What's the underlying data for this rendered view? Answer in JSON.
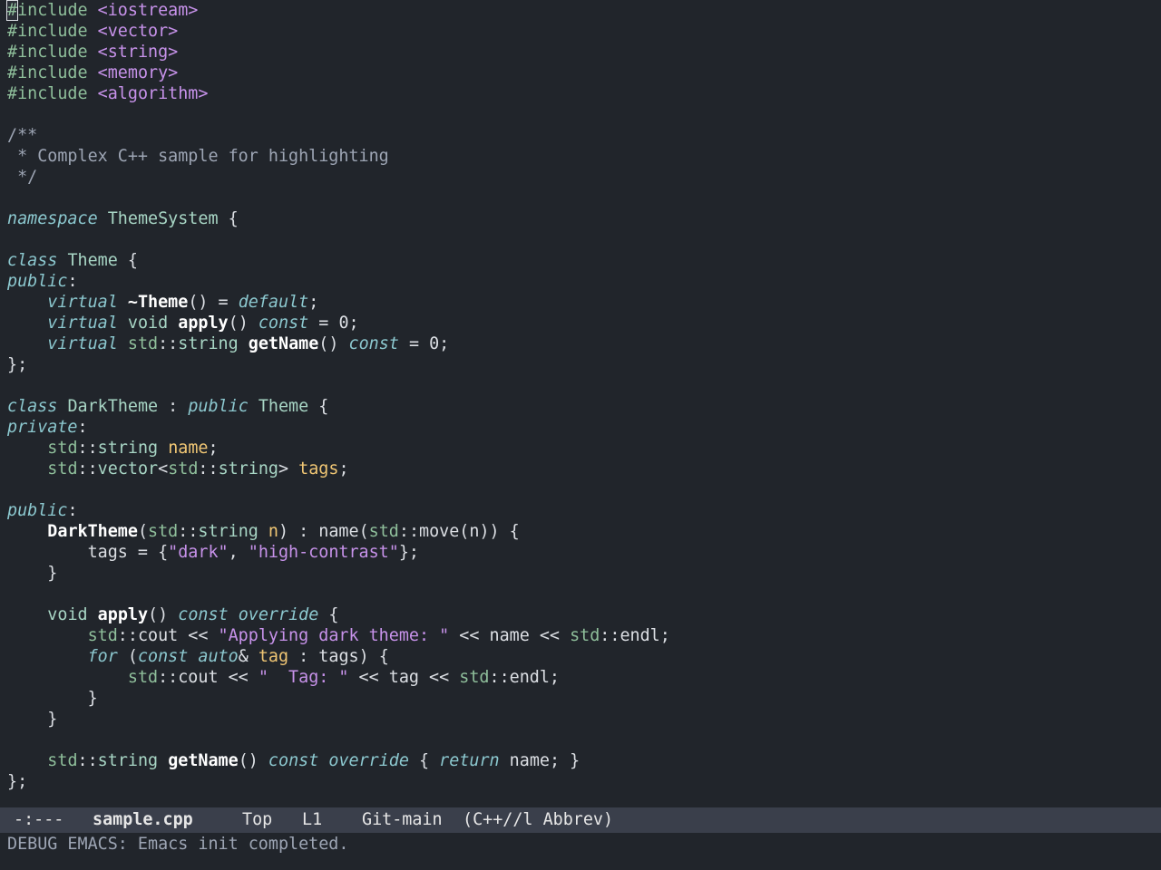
{
  "buffer": {
    "lines": [
      [
        [
          "pp",
          "#include "
        ],
        [
          "inc",
          "<iostream>"
        ]
      ],
      [
        [
          "pp",
          "#include "
        ],
        [
          "inc",
          "<vector>"
        ]
      ],
      [
        [
          "pp",
          "#include "
        ],
        [
          "inc",
          "<string>"
        ]
      ],
      [
        [
          "pp",
          "#include "
        ],
        [
          "inc",
          "<memory>"
        ]
      ],
      [
        [
          "pp",
          "#include "
        ],
        [
          "inc",
          "<algorithm>"
        ]
      ],
      [],
      [
        [
          "cm",
          "/**"
        ]
      ],
      [
        [
          "cm",
          " * Complex C++ sample for highlighting"
        ]
      ],
      [
        [
          "cm",
          " */"
        ]
      ],
      [],
      [
        [
          "kw",
          "namespace"
        ],
        [
          "pl",
          " "
        ],
        [
          "ty",
          "ThemeSystem"
        ],
        [
          "pl",
          " {"
        ]
      ],
      [],
      [
        [
          "kw",
          "class"
        ],
        [
          "pl",
          " "
        ],
        [
          "ty",
          "Theme"
        ],
        [
          "pl",
          " {"
        ]
      ],
      [
        [
          "kw",
          "public"
        ],
        [
          "pl",
          ":"
        ]
      ],
      [
        [
          "pl",
          "    "
        ],
        [
          "kw",
          "virtual"
        ],
        [
          "pl",
          " "
        ],
        [
          "fn",
          "~Theme"
        ],
        [
          "pl",
          "() = "
        ],
        [
          "kw",
          "default"
        ],
        [
          "pl",
          ";"
        ]
      ],
      [
        [
          "pl",
          "    "
        ],
        [
          "kw",
          "virtual"
        ],
        [
          "pl",
          " "
        ],
        [
          "ty",
          "void"
        ],
        [
          "pl",
          " "
        ],
        [
          "fn",
          "apply"
        ],
        [
          "pl",
          "() "
        ],
        [
          "kw",
          "const"
        ],
        [
          "pl",
          " = 0;"
        ]
      ],
      [
        [
          "pl",
          "    "
        ],
        [
          "kw",
          "virtual"
        ],
        [
          "pl",
          " "
        ],
        [
          "ns",
          "std"
        ],
        [
          "pl",
          "::"
        ],
        [
          "ty",
          "string"
        ],
        [
          "pl",
          " "
        ],
        [
          "fn",
          "getName"
        ],
        [
          "pl",
          "() "
        ],
        [
          "kw",
          "const"
        ],
        [
          "pl",
          " = 0;"
        ]
      ],
      [
        [
          "pl",
          "};"
        ]
      ],
      [],
      [
        [
          "kw",
          "class"
        ],
        [
          "pl",
          " "
        ],
        [
          "ty",
          "DarkTheme"
        ],
        [
          "pl",
          " : "
        ],
        [
          "kw",
          "public"
        ],
        [
          "pl",
          " "
        ],
        [
          "ty",
          "Theme"
        ],
        [
          "pl",
          " {"
        ]
      ],
      [
        [
          "kw",
          "private"
        ],
        [
          "pl",
          ":"
        ]
      ],
      [
        [
          "pl",
          "    "
        ],
        [
          "ns",
          "std"
        ],
        [
          "pl",
          "::"
        ],
        [
          "ty",
          "string"
        ],
        [
          "pl",
          " "
        ],
        [
          "vr",
          "name"
        ],
        [
          "pl",
          ";"
        ]
      ],
      [
        [
          "pl",
          "    "
        ],
        [
          "ns",
          "std"
        ],
        [
          "pl",
          "::"
        ],
        [
          "ty",
          "vector"
        ],
        [
          "pl",
          "<"
        ],
        [
          "ns",
          "std"
        ],
        [
          "pl",
          "::"
        ],
        [
          "ty",
          "string"
        ],
        [
          "pl",
          "> "
        ],
        [
          "vr",
          "tags"
        ],
        [
          "pl",
          ";"
        ]
      ],
      [],
      [
        [
          "kw",
          "public"
        ],
        [
          "pl",
          ":"
        ]
      ],
      [
        [
          "pl",
          "    "
        ],
        [
          "fn",
          "DarkTheme"
        ],
        [
          "pl",
          "("
        ],
        [
          "ns",
          "std"
        ],
        [
          "pl",
          "::"
        ],
        [
          "ty",
          "string"
        ],
        [
          "pl",
          " "
        ],
        [
          "vr",
          "n"
        ],
        [
          "pl",
          ") : name("
        ],
        [
          "ns",
          "std"
        ],
        [
          "pl",
          "::move(n)) {"
        ]
      ],
      [
        [
          "pl",
          "        tags = {"
        ],
        [
          "st",
          "\"dark\""
        ],
        [
          "pl",
          ", "
        ],
        [
          "st",
          "\"high-contrast\""
        ],
        [
          "pl",
          "};"
        ]
      ],
      [
        [
          "pl",
          "    }"
        ]
      ],
      [],
      [
        [
          "pl",
          "    "
        ],
        [
          "ty",
          "void"
        ],
        [
          "pl",
          " "
        ],
        [
          "fn",
          "apply"
        ],
        [
          "pl",
          "() "
        ],
        [
          "kw",
          "const"
        ],
        [
          "pl",
          " "
        ],
        [
          "kw",
          "override"
        ],
        [
          "pl",
          " {"
        ]
      ],
      [
        [
          "pl",
          "        "
        ],
        [
          "ns",
          "std"
        ],
        [
          "pl",
          "::cout << "
        ],
        [
          "st",
          "\"Applying dark theme: \""
        ],
        [
          "pl",
          " << name << "
        ],
        [
          "ns",
          "std"
        ],
        [
          "pl",
          "::endl;"
        ]
      ],
      [
        [
          "pl",
          "        "
        ],
        [
          "kw",
          "for"
        ],
        [
          "pl",
          " ("
        ],
        [
          "kw",
          "const"
        ],
        [
          "pl",
          " "
        ],
        [
          "kw",
          "auto"
        ],
        [
          "pl",
          "& "
        ],
        [
          "vr",
          "tag"
        ],
        [
          "pl",
          " : tags) {"
        ]
      ],
      [
        [
          "pl",
          "            "
        ],
        [
          "ns",
          "std"
        ],
        [
          "pl",
          "::cout << "
        ],
        [
          "st",
          "\"  Tag: \""
        ],
        [
          "pl",
          " << tag << "
        ],
        [
          "ns",
          "std"
        ],
        [
          "pl",
          "::endl;"
        ]
      ],
      [
        [
          "pl",
          "        }"
        ]
      ],
      [
        [
          "pl",
          "    }"
        ]
      ],
      [],
      [
        [
          "pl",
          "    "
        ],
        [
          "ns",
          "std"
        ],
        [
          "pl",
          "::"
        ],
        [
          "ty",
          "string"
        ],
        [
          "pl",
          " "
        ],
        [
          "fn",
          "getName"
        ],
        [
          "pl",
          "() "
        ],
        [
          "kw",
          "const"
        ],
        [
          "pl",
          " "
        ],
        [
          "kw",
          "override"
        ],
        [
          "pl",
          " { "
        ],
        [
          "kw",
          "return"
        ],
        [
          "pl",
          " name; }"
        ]
      ],
      [
        [
          "pl",
          "};"
        ]
      ]
    ]
  },
  "modeline": {
    "status": "-:---",
    "filename": "sample.cpp",
    "position": "Top",
    "line": "L1",
    "vcs": "Git-main",
    "modes": "(C++//l Abbrev)"
  },
  "echo_area": {
    "message": "DEBUG EMACS: Emacs init completed."
  },
  "colors": {
    "background": "#21252b",
    "modeline_bg": "#3a3f4b",
    "keyword": "#8cc8cf",
    "string": "#c792ea",
    "variable": "#f0c674",
    "comment": "#9da5b4"
  }
}
